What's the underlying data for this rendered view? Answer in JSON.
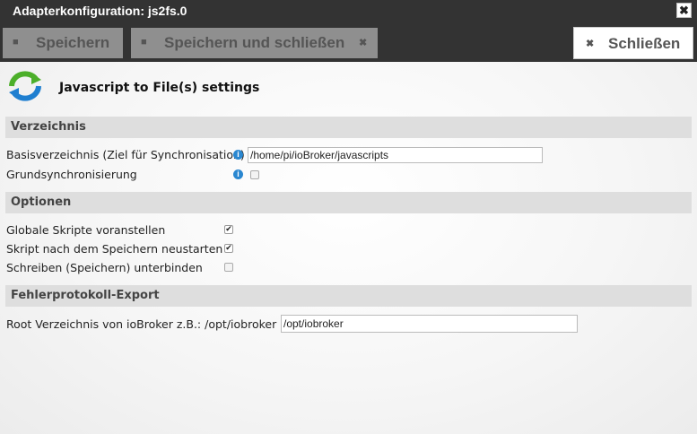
{
  "window": {
    "title": "Adapterkonfiguration: js2fs.0",
    "close_glyph": "✖"
  },
  "toolbar": {
    "save_label": "Speichern",
    "save_close_label": "Speichern und schließen",
    "close_label": "Schließen"
  },
  "header": {
    "title": "Javascript to File(s) settings"
  },
  "sections": {
    "verzeichnis": "Verzeichnis",
    "optionen": "Optionen",
    "fehlerprotokoll": "Fehlerprotokoll-Export"
  },
  "fields": {
    "basisverzeichnis_label": "Basisverzeichnis (Ziel für Synchronisation)",
    "basisverzeichnis_value": "/home/pi/ioBroker/javascripts",
    "grundsync_label": "Grundsynchronisierung",
    "grundsync_checked": false,
    "globale_skripte_label": "Globale Skripte voranstellen",
    "globale_skripte_checked": true,
    "neustarten_label": "Skript nach dem Speichern neustarten",
    "neustarten_checked": true,
    "schreiben_label": "Schreiben (Speichern) unterbinden",
    "schreiben_checked": false,
    "root_label": "Root Verzeichnis von ioBroker z.B.: /opt/iobroker",
    "root_value": "/opt/iobroker"
  },
  "icons": {
    "save": "floppy-disk-icon",
    "close": "x-icon",
    "info": "info-icon",
    "logo": "sync-arrows-icon"
  },
  "colors": {
    "titlebar": "#333333",
    "disabled_button": "#8f8f8f",
    "section_bar": "#dedede",
    "info": "#2a87d0",
    "logo_green": "#4caf2a",
    "logo_blue": "#1f7fd0"
  }
}
